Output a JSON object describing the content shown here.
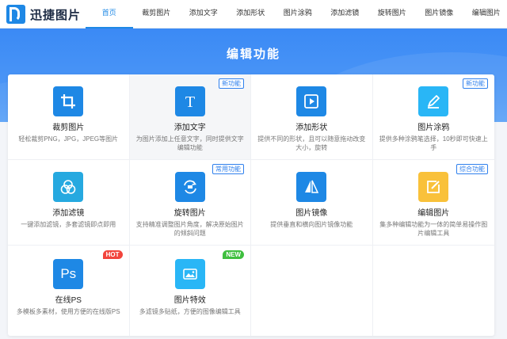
{
  "header": {
    "logo_text": "迅捷图片",
    "nav": [
      "首页",
      "裁剪图片",
      "添加文字",
      "添加形状",
      "图片涂鸦",
      "添加滤镜",
      "旋转图片",
      "图片镜像",
      "编辑图片"
    ],
    "active_index": 0
  },
  "banner": {
    "title": "编辑功能"
  },
  "tools": [
    {
      "title": "裁剪图片",
      "desc": "轻松裁剪PNG，JPG，JPEG等图片",
      "icon": "crop-icon",
      "color": "#1e88e5",
      "badge": ""
    },
    {
      "title": "添加文字",
      "desc": "为图片添加上任意文字，同时提供文字\n编辑功能",
      "icon": "text-icon",
      "color": "#1e88e5",
      "badge": "新功能"
    },
    {
      "title": "添加形状",
      "desc": "提供不同的形状，且可以随意拖动改变\n大小，旋转",
      "icon": "shape-icon",
      "color": "#1e88e5",
      "badge": ""
    },
    {
      "title": "图片涂鸦",
      "desc": "提供多种涂鸦笔选择，10秒即可快速上手",
      "icon": "brush-icon",
      "color": "#29b6f6",
      "badge": "新功能"
    },
    {
      "title": "添加滤镜",
      "desc": "一键添加滤镜，多套滤镜即点即用",
      "icon": "filter-icon",
      "color": "#26a9e0",
      "badge": ""
    },
    {
      "title": "旋转图片",
      "desc": "支持精准调整图片角度，解决原始图片的倾斜问题",
      "icon": "rotate-icon",
      "color": "#1e88e5",
      "badge": "常用功能"
    },
    {
      "title": "图片镜像",
      "desc": "提供垂直和横向图片镜像功能",
      "icon": "mirror-icon",
      "color": "#1e88e5",
      "badge": ""
    },
    {
      "title": "编辑图片",
      "desc": "集多种编辑功能为一体的简单易操作图片编辑工具",
      "icon": "edit-icon",
      "color": "#f9c13a",
      "badge": "综合功能"
    },
    {
      "title": "在线PS",
      "desc": "多模板多素材，使用方便的在线版PS",
      "icon": "ps-icon",
      "color": "#1e88e5",
      "badge": "HOT"
    },
    {
      "title": "图片特效",
      "desc": "多滤镜多贴纸，方便的图像编辑工具",
      "icon": "effect-icon",
      "color": "#29b6f6",
      "badge": "NEW"
    }
  ],
  "ps_text": "Ps"
}
